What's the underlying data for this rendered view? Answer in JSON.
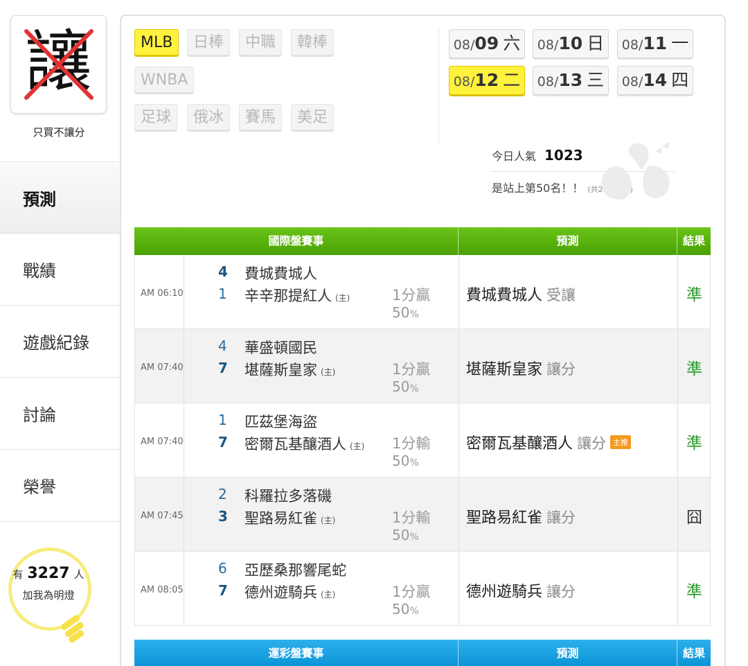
{
  "sidebar": {
    "avatar_char": "讓",
    "avatar_caption": "只買不讓分",
    "nav": [
      "預測",
      "戰績",
      "遊戲紀錄",
      "討論",
      "榮譽"
    ],
    "fans_prefix": "有",
    "fans_count": "3227",
    "fans_suffix": "人",
    "fans_action": "加我為明燈"
  },
  "leagues": [
    "MLB",
    "日棒",
    "中職",
    "韓棒",
    "WNBA",
    "足球",
    "俄冰",
    "賽馬",
    "美足"
  ],
  "active_league": "MLB",
  "dates": [
    {
      "md": "08/",
      "day": "09",
      "wd": "六"
    },
    {
      "md": "08/",
      "day": "10",
      "wd": "日"
    },
    {
      "md": "08/",
      "day": "11",
      "wd": "一"
    },
    {
      "md": "08/",
      "day": "12",
      "wd": "二"
    },
    {
      "md": "08/",
      "day": "13",
      "wd": "三"
    },
    {
      "md": "08/",
      "day": "14",
      "wd": "四"
    }
  ],
  "active_date": "08/12",
  "popularity": {
    "label": "今日人氣",
    "value": "1023",
    "rank_text": "是站上第50名！！",
    "total": "(共25524人)"
  },
  "table1": {
    "headers": [
      "國際盤賽事",
      "預測",
      "結果"
    ],
    "rows": [
      {
        "time": "AM 06:10",
        "away": "費城費城人",
        "away_score": "4",
        "home": "辛辛那提紅人",
        "home_score": "1",
        "home_mark": "(主)",
        "spread": "1分贏",
        "pct": "50",
        "pct_unit": "%",
        "pick": "費城費城人",
        "pick_note": "受讓",
        "badge": "",
        "result": "準"
      },
      {
        "time": "AM 07:40",
        "away": "華盛頓國民",
        "away_score": "4",
        "home": "堪薩斯皇家",
        "home_score": "7",
        "home_mark": "(主)",
        "spread": "1分贏",
        "pct": "50",
        "pct_unit": "%",
        "pick": "堪薩斯皇家",
        "pick_note": "讓分",
        "badge": "",
        "result": "準"
      },
      {
        "time": "AM 07:40",
        "away": "匹茲堡海盜",
        "away_score": "1",
        "home": "密爾瓦基釀酒人",
        "home_score": "7",
        "home_mark": "(主)",
        "spread": "1分輸",
        "pct": "50",
        "pct_unit": "%",
        "pick": "密爾瓦基釀酒人",
        "pick_note": "讓分",
        "badge": "主推",
        "result": "準"
      },
      {
        "time": "AM 07:45",
        "away": "科羅拉多落磯",
        "away_score": "2",
        "home": "聖路易紅雀",
        "home_score": "3",
        "home_mark": "(主)",
        "spread": "1分輸",
        "pct": "50",
        "pct_unit": "%",
        "pick": "聖路易紅雀",
        "pick_note": "讓分",
        "badge": "",
        "result": "囧"
      },
      {
        "time": "AM 08:05",
        "away": "亞歷桑那響尾蛇",
        "away_score": "6",
        "home": "德州遊騎兵",
        "home_score": "7",
        "home_mark": "(主)",
        "spread": "1分贏",
        "pct": "50",
        "pct_unit": "%",
        "pick": "德州遊騎兵",
        "pick_note": "讓分",
        "badge": "",
        "result": "準"
      }
    ]
  },
  "table2": {
    "headers": [
      "運彩盤賽事",
      "預測",
      "結果"
    ]
  },
  "colors": {
    "accent_yellow": "#fff23d",
    "header_green": "#5ab30b",
    "header_blue": "#1aa2e2",
    "win_green": "#2a9a2a"
  }
}
